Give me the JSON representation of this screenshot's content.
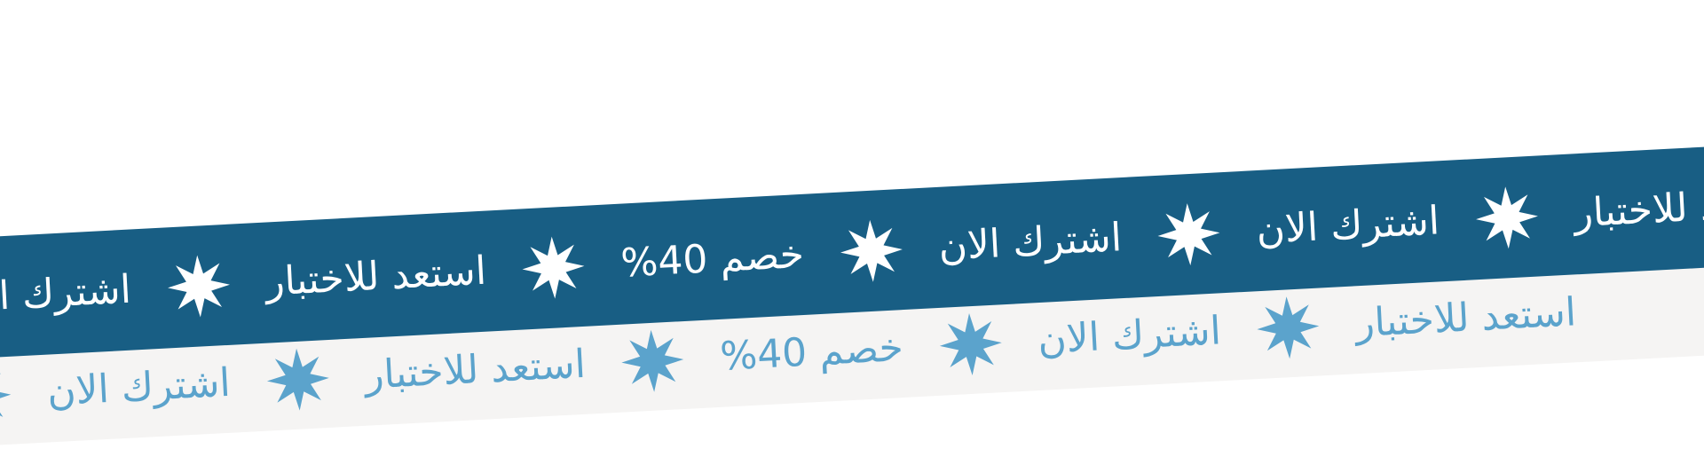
{
  "colors": {
    "dark_band": "#185e84",
    "light_band": "#f5f4f3",
    "dark_text": "#ffffff",
    "light_text": "#5ba3cc"
  },
  "icon": "eight-point-star-icon",
  "dark_ribbon": {
    "items": [
      "اشترك الان",
      "استعد للاختبار",
      "خصم 40%",
      "اشترك الان",
      "اشترك الان",
      "استعد للاختبار"
    ]
  },
  "light_ribbon": {
    "items": [
      "اشترك الان",
      "استعد للاختبار",
      "خصم 40%",
      "اشترك الان",
      "استعد للاختبار"
    ]
  }
}
